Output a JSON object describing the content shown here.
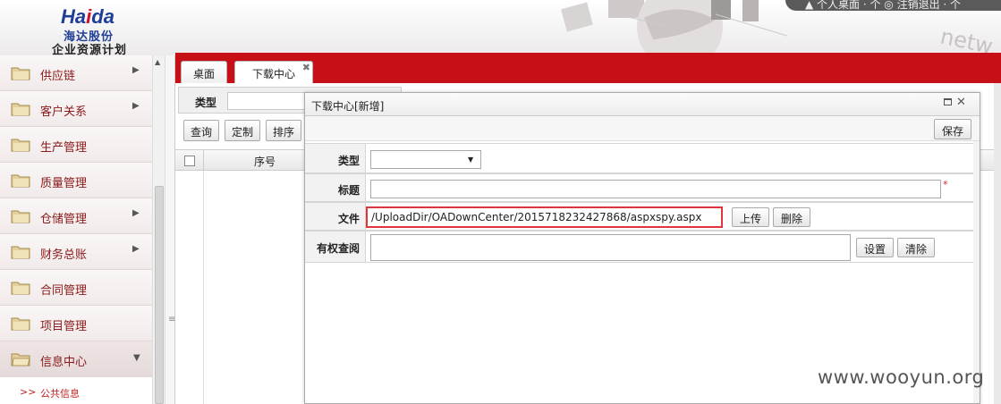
{
  "header": {
    "logo_latin_a": "Ha",
    "logo_latin_b": "i",
    "logo_latin_c": "da",
    "logo_cn": "海达股份",
    "logo_sub": "企业资源计划",
    "art_text": "netw",
    "user_bar_text": "▲ 个人桌面 · 个 ◎ 注销退出 · 个"
  },
  "sidebar": {
    "items": [
      {
        "label": "供应链",
        "arrow": "▶"
      },
      {
        "label": "客户关系",
        "arrow": "▶"
      },
      {
        "label": "生产管理",
        "arrow": ""
      },
      {
        "label": "质量管理",
        "arrow": ""
      },
      {
        "label": "仓储管理",
        "arrow": "▶"
      },
      {
        "label": "财务总账",
        "arrow": "▶"
      },
      {
        "label": "合同管理",
        "arrow": ""
      },
      {
        "label": "项目管理",
        "arrow": ""
      },
      {
        "label": "信息中心",
        "arrow": "▼"
      }
    ],
    "sub_item": {
      "chevron": ">>",
      "label": "公共信息"
    }
  },
  "tabs": [
    {
      "label": "桌面"
    },
    {
      "label": "下载中心",
      "close": "✖"
    }
  ],
  "background_panel": {
    "filter_label": "类型",
    "buttons": {
      "query": "查询",
      "custom": "定制",
      "sort": "排序"
    },
    "grid_header": "序号"
  },
  "dialog": {
    "title": "下载中心[新增]",
    "close_glyph": "✕",
    "save_label": "保存",
    "fields": {
      "type_label": "类型",
      "title_label": "标题",
      "title_required": "*",
      "file_label": "文件",
      "file_value": "/UploadDir/OADownCenter/2015718232427868/aspxspy.aspx",
      "perm_label": "有权查阅"
    },
    "buttons": {
      "upload": "上传",
      "delete": "删除",
      "set": "设置",
      "clear": "清除"
    }
  },
  "watermark": "www.wooyun.org",
  "colors": {
    "brand_red": "#c70f18",
    "logo_blue": "#1f3f97",
    "highlight_border": "#e0353b"
  }
}
